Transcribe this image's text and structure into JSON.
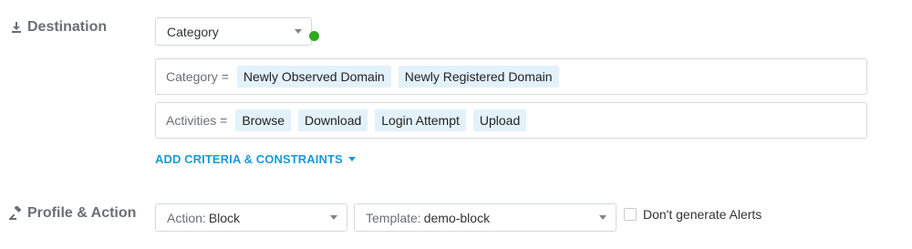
{
  "destination": {
    "label": "Destination",
    "icon": "download-icon",
    "select": {
      "value": "Category"
    },
    "status_color": "#2fa81b",
    "criteria": [
      {
        "key": "Category =",
        "tags": [
          "Newly Observed Domain",
          "Newly Registered Domain"
        ]
      },
      {
        "key": "Activities =",
        "tags": [
          "Browse",
          "Download",
          "Login Attempt",
          "Upload"
        ]
      }
    ],
    "add_criteria_label": "ADD CRITERIA & CONSTRAINTS"
  },
  "profile_action": {
    "label": "Profile & Action",
    "icon": "gavel-icon",
    "action": {
      "prefix": "Action:",
      "value": "Block"
    },
    "template": {
      "prefix": "Template:",
      "value": "demo-block"
    },
    "alerts_checkbox": {
      "label": "Don't generate Alerts",
      "checked": false
    }
  }
}
